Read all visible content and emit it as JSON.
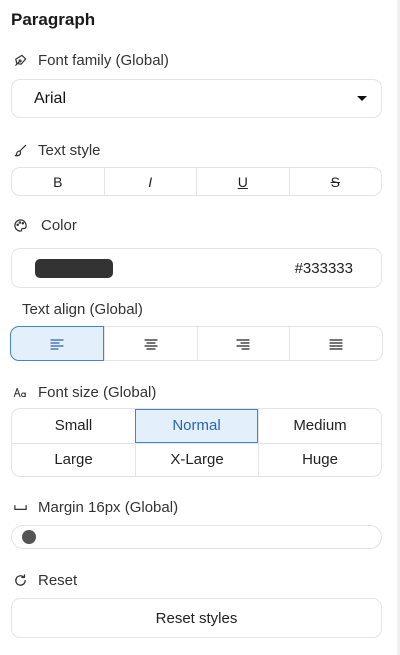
{
  "title": "Paragraph",
  "font_family": {
    "label": "Font family (Global)",
    "value": "Arial"
  },
  "text_style": {
    "label": "Text style",
    "buttons": [
      {
        "name": "bold",
        "glyph": "B"
      },
      {
        "name": "italic",
        "glyph": "I"
      },
      {
        "name": "underline",
        "glyph": "U"
      },
      {
        "name": "strikethrough",
        "glyph": "S"
      }
    ]
  },
  "color": {
    "label": "Color",
    "value": "#333333",
    "swatch": "#333333"
  },
  "text_align": {
    "label": "Text align (Global)",
    "options": [
      "left",
      "center",
      "right",
      "justify"
    ],
    "selected": "left"
  },
  "font_size": {
    "label": "Font size (Global)",
    "options": [
      "Small",
      "Normal",
      "Medium",
      "Large",
      "X-Large",
      "Huge"
    ],
    "selected": "Normal"
  },
  "margin": {
    "label": "Margin 16px (Global)",
    "value": 0
  },
  "reset": {
    "label": "Reset",
    "button": "Reset styles"
  },
  "colors": {
    "accent": "#3f84d6",
    "accent_bg": "#e4effc",
    "border": "#e4e4e4"
  }
}
